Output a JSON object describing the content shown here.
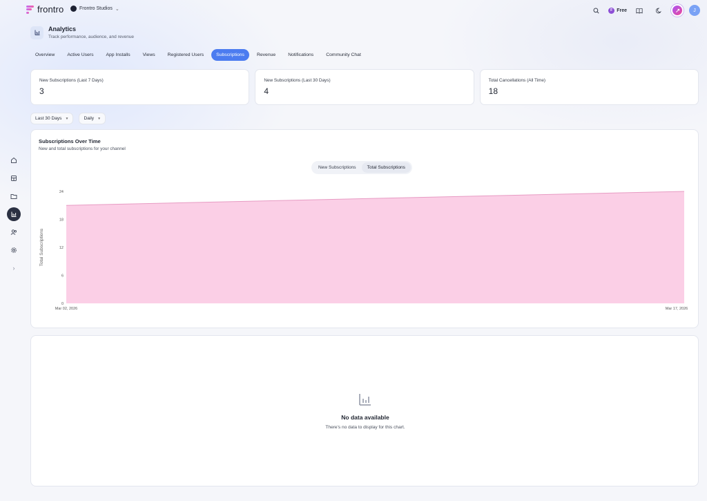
{
  "app": {
    "name": "frontro",
    "workspace": "Frontro Studios",
    "plan": "Free",
    "avatar_initial": "F",
    "user_initial": "J"
  },
  "icons": {
    "logo": "frontro-logo-icon",
    "search": "search-icon",
    "book": "book-icon",
    "theme": "moon-icon"
  },
  "header": {
    "title": "Analytics",
    "subtitle": "Track performance, audience, and revenue"
  },
  "tabs": [
    {
      "label": "Overview",
      "active": false
    },
    {
      "label": "Active Users",
      "active": false
    },
    {
      "label": "App Installs",
      "active": false
    },
    {
      "label": "Views",
      "active": false
    },
    {
      "label": "Registered Users",
      "active": false
    },
    {
      "label": "Subscriptions",
      "active": true
    },
    {
      "label": "Revenue",
      "active": false
    },
    {
      "label": "Notifications",
      "active": false
    },
    {
      "label": "Community Chat",
      "active": false
    }
  ],
  "stats": [
    {
      "label": "New Subscriptions (Last 7 Days)",
      "value": "3"
    },
    {
      "label": "New Subscriptions (Last 30 Days)",
      "value": "4"
    },
    {
      "label": "Total Cancellations (All Time)",
      "value": "18"
    }
  ],
  "filters": {
    "range": "Last 30 Days",
    "interval": "Daily"
  },
  "chart_card": {
    "title": "Subscriptions Over Time",
    "subtitle": "New and total subscriptions for your channel",
    "toggle": [
      "New Subscriptions",
      "Total Subscriptions"
    ],
    "toggle_active": 1
  },
  "chart_data": {
    "type": "area",
    "x": [
      "Mar 02, 2026",
      "Mar 17, 2026"
    ],
    "series": [
      {
        "values": [
          21,
          24
        ]
      }
    ],
    "ylabel": "Total Subscriptions",
    "xlabel": "",
    "yticks": [
      "0",
      "6",
      "12",
      "18",
      "24"
    ],
    "xticks": [
      "Mar 02, 2026",
      "Mar 17, 2026"
    ],
    "ylim": [
      0,
      24
    ],
    "fill_color": "#fbcfe6",
    "line_color": "#e79bc3",
    "grid": false
  },
  "empty_state": {
    "title": "No data available",
    "subtitle": "There's no data to display for this chart."
  },
  "colors": {
    "accent": "#4c7cf0",
    "sidebar_active": "#2b3142"
  }
}
